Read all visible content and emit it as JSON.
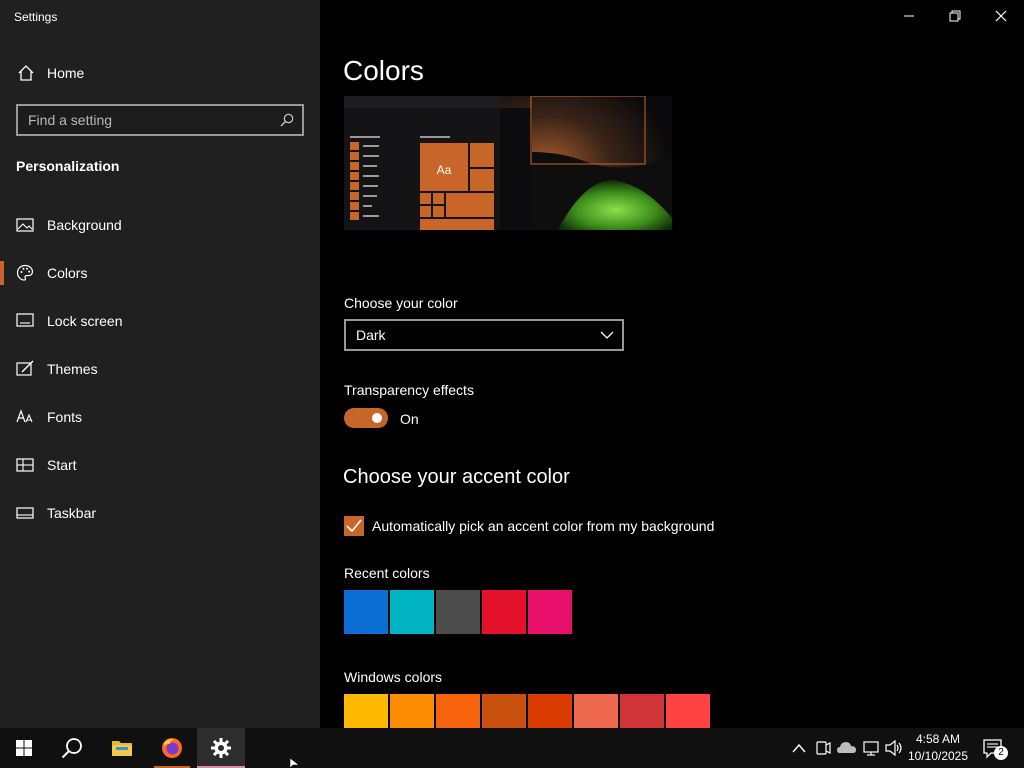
{
  "window": {
    "title": "Settings"
  },
  "sidebar": {
    "home_label": "Home",
    "search_placeholder": "Find a setting",
    "section_title": "Personalization",
    "items": [
      {
        "label": "Background",
        "icon": "picture-icon"
      },
      {
        "label": "Colors",
        "icon": "palette-icon",
        "active": true
      },
      {
        "label": "Lock screen",
        "icon": "lock-screen-icon"
      },
      {
        "label": "Themes",
        "icon": "brush-icon"
      },
      {
        "label": "Fonts",
        "icon": "font-icon"
      },
      {
        "label": "Start",
        "icon": "start-icon"
      },
      {
        "label": "Taskbar",
        "icon": "taskbar-icon"
      }
    ]
  },
  "main": {
    "title": "Colors",
    "preview": {
      "tile_text": "Aa"
    },
    "choose_color": {
      "label": "Choose your color",
      "value": "Dark"
    },
    "transparency": {
      "label": "Transparency effects",
      "state": "On",
      "enabled": true
    },
    "accent_heading": "Choose your accent color",
    "auto_pick": {
      "label": "Automatically pick an accent color from my background",
      "checked": true
    },
    "recent_colors": {
      "label": "Recent colors",
      "colors": [
        "#0b6fd4",
        "#00b4c4",
        "#4c4c4c",
        "#e3112a",
        "#e8106a"
      ]
    },
    "windows_colors": {
      "label": "Windows colors",
      "colors": [
        "#ffb900",
        "#ff8c00",
        "#f7630c",
        "#ca5010",
        "#da3b01",
        "#ef6950",
        "#d13438",
        "#ff4343"
      ]
    }
  },
  "accent_color": "#c8662a",
  "taskbar": {
    "apps": [
      "start-icon",
      "search-icon",
      "file-explorer-icon",
      "firefox-icon",
      "settings-icon"
    ],
    "clock_time": "4:58 AM",
    "clock_date": "10/10/2025",
    "notification_count": "2"
  }
}
